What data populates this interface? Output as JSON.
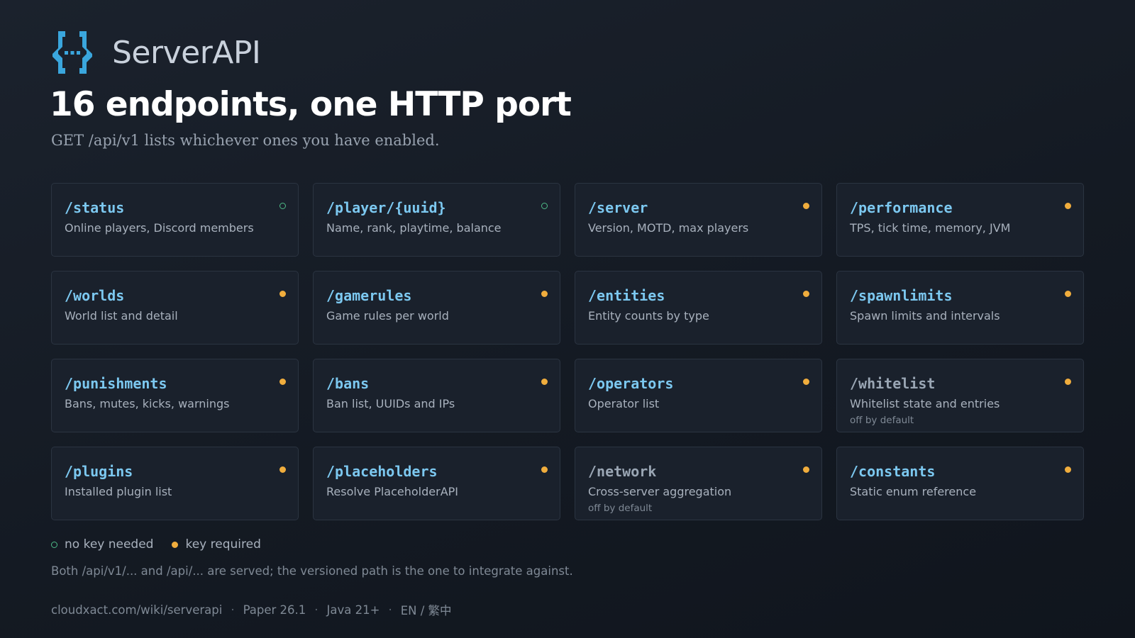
{
  "app": {
    "name": "ServerAPI",
    "logo_icon": "braces-ellipsis-icon"
  },
  "headline": "16 endpoints, one HTTP port",
  "subline": "GET /api/v1 lists whichever ones you have enabled.",
  "colors": {
    "accent": "#7cc8f0",
    "key_required": "#f0ad3d",
    "no_key": "#4ebb87",
    "logo": "#3aa6dd"
  },
  "endpoints": [
    {
      "path": "/status",
      "desc": "Online players, Discord members",
      "auth": "no-key"
    },
    {
      "path": "/player/{uuid}",
      "desc": "Name, rank, playtime, balance",
      "auth": "no-key"
    },
    {
      "path": "/server",
      "desc": "Version, MOTD, max players",
      "auth": "key"
    },
    {
      "path": "/performance",
      "desc": "TPS, tick time, memory, JVM",
      "auth": "key"
    },
    {
      "path": "/worlds",
      "desc": "World list and detail",
      "auth": "key"
    },
    {
      "path": "/gamerules",
      "desc": "Game rules per world",
      "auth": "key"
    },
    {
      "path": "/entities",
      "desc": "Entity counts by type",
      "auth": "key"
    },
    {
      "path": "/spawnlimits",
      "desc": "Spawn limits and intervals",
      "auth": "key"
    },
    {
      "path": "/punishments",
      "desc": "Bans, mutes, kicks, warnings",
      "auth": "key"
    },
    {
      "path": "/bans",
      "desc": "Ban list, UUIDs and IPs",
      "auth": "key"
    },
    {
      "path": "/operators",
      "desc": "Operator list",
      "auth": "key"
    },
    {
      "path": "/whitelist",
      "desc": "Whitelist state and entries",
      "auth": "key",
      "note": "off by default"
    },
    {
      "path": "/plugins",
      "desc": "Installed plugin list",
      "auth": "key"
    },
    {
      "path": "/placeholders",
      "desc": "Resolve PlaceholderAPI",
      "auth": "key"
    },
    {
      "path": "/network",
      "desc": "Cross-server aggregation",
      "auth": "key",
      "note": "off by default"
    },
    {
      "path": "/constants",
      "desc": "Static enum reference",
      "auth": "key"
    }
  ],
  "legend": {
    "no_key": "no key needed",
    "key_required": "key required"
  },
  "footnote": "Both /api/v1/... and /api/... are served; the versioned path is the one to integrate against.",
  "footer": {
    "url": "cloudxact.com/wiki/serverapi",
    "platform": "Paper 26.1",
    "java": "Java 21+",
    "languages": "EN / 繁中",
    "separator": "·"
  }
}
